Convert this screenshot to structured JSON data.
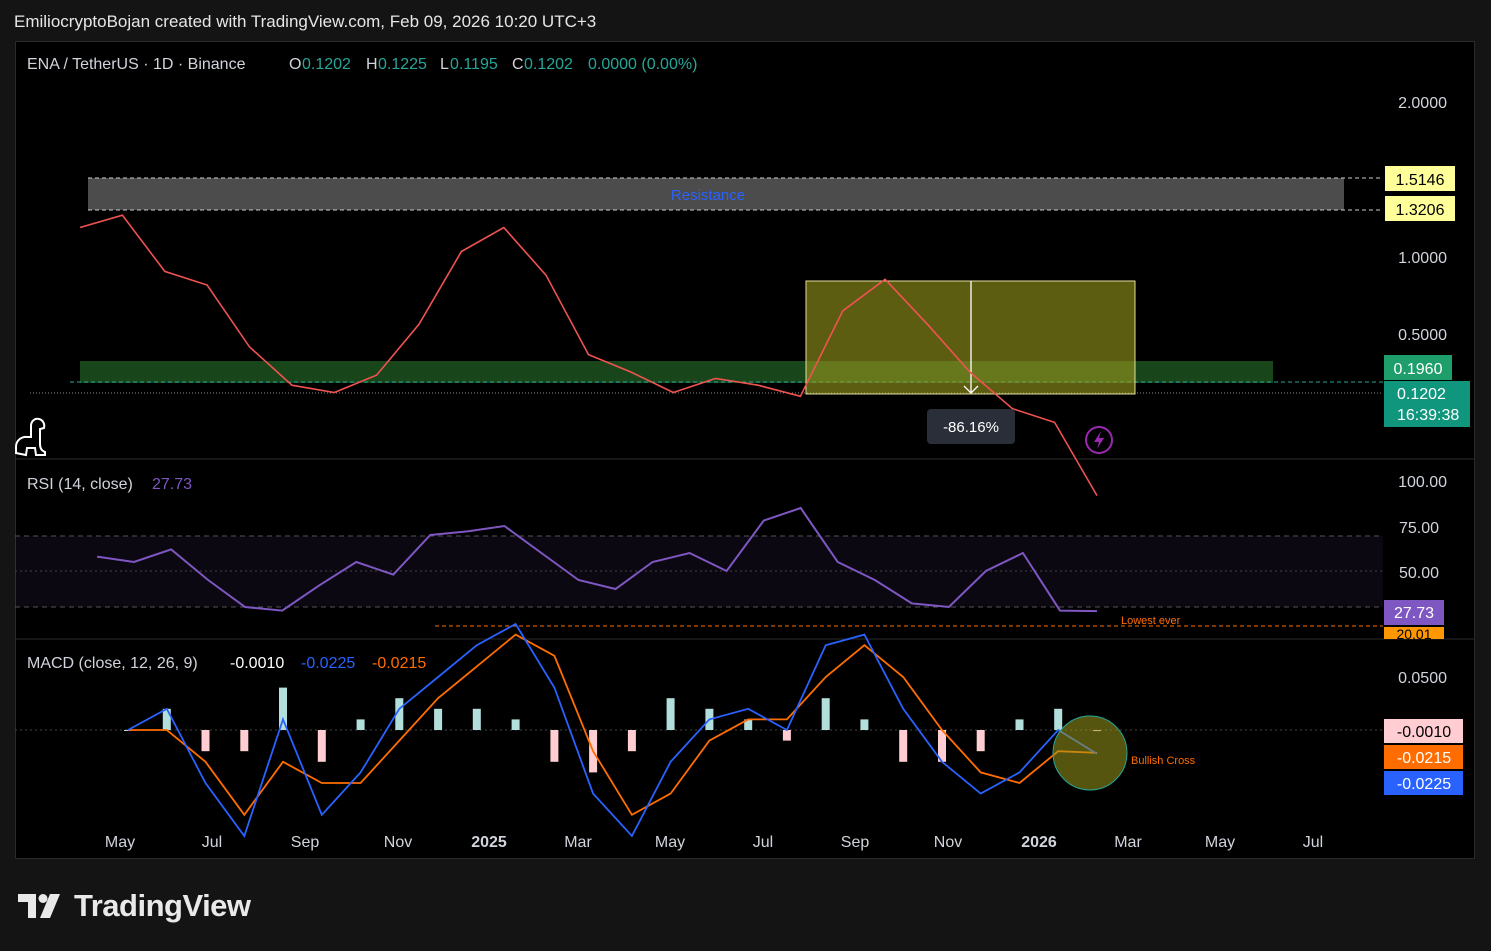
{
  "header": {
    "attribution": "EmiliocryptoBojan created with TradingView.com, Feb 09, 2026 10:20 UTC+3"
  },
  "legend": {
    "symbol": "ENA / TetherUS · 1D · Binance",
    "o_label": "O",
    "o_value": "0.1202",
    "h_label": "H",
    "h_value": "0.1225",
    "l_label": "L",
    "l_value": "0.1195",
    "c_label": "C",
    "c_value": "0.1202",
    "change": "0.0000 (0.00%)"
  },
  "price_axis": [
    "2.0000",
    "1.0000",
    "0.5000"
  ],
  "price_tags": {
    "resistance_top": "1.5146",
    "resistance_bottom": "1.3206",
    "support": "0.1960",
    "last": "0.1202",
    "countdown": "16:39:38"
  },
  "annotations": {
    "resistance": "Resistance",
    "drop_pct": "-86.16%",
    "lowest_ever": "Lowest ever",
    "bullish_cross": "Bullish Cross"
  },
  "rsi": {
    "title": "RSI (14, close)",
    "value": "27.73",
    "axis": [
      "100.00",
      "75.00",
      "50.00"
    ],
    "tag_value": "27.73",
    "tag_low": "20.01"
  },
  "macd": {
    "title": "MACD (close, 12, 26, 9)",
    "hist": "-0.0010",
    "macd": "-0.0225",
    "signal": "-0.0215",
    "axis": [
      "0.0500"
    ],
    "tag_hist": "-0.0010",
    "tag_signal": "-0.0215",
    "tag_macd": "-0.0225"
  },
  "time_axis": [
    "May",
    "Jul",
    "Sep",
    "Nov",
    "2025",
    "Mar",
    "May",
    "Jul",
    "Sep",
    "Nov",
    "2026",
    "Mar",
    "May",
    "Jul"
  ],
  "colors": {
    "up": "#26a69a",
    "down": "#ef5350",
    "rsi": "#7e57c2",
    "macd": "#2962ff",
    "signal": "#ff6d00",
    "tag_yellow": "#ffff99",
    "tag_green": "#1e9e6a",
    "projection": "#7a7a1a"
  },
  "brand": {
    "name": "TradingView"
  },
  "chart_data": {
    "type": "line",
    "title": "ENA / TetherUS · 1D · Binance",
    "x": [
      "2024-04",
      "2024-04",
      "2024-05",
      "2024-06",
      "2024-07",
      "2024-08",
      "2024-09",
      "2024-10",
      "2024-11",
      "2024-12",
      "2024-12",
      "2025-01",
      "2025-02",
      "2025-03",
      "2025-04",
      "2025-05",
      "2025-06",
      "2025-07",
      "2025-08",
      "2025-09",
      "2025-10",
      "2025-11",
      "2025-12",
      "2026-01",
      "2026-02"
    ],
    "series": [
      {
        "values": [
          1.3,
          1.45,
          0.88,
          0.78,
          0.45,
          0.32,
          0.3,
          0.35,
          0.55,
          1.05,
          1.3,
          0.85,
          0.42,
          0.36,
          0.3,
          0.34,
          0.32,
          0.29,
          0.62,
          0.82,
          0.55,
          0.36,
          0.26,
          0.23,
          0.12
        ]
      }
    ],
    "ylim": [
      0.1,
      2.2
    ],
    "log_scale": true,
    "levels": {
      "resistance_top": 1.5146,
      "resistance_bottom": 1.3206,
      "support": 0.196,
      "last": 0.1202
    },
    "rsi_series": [
      58,
      55,
      62,
      45,
      30,
      28,
      42,
      55,
      48,
      70,
      72,
      75,
      60,
      45,
      40,
      55,
      60,
      50,
      78,
      85,
      55,
      45,
      32,
      30,
      50,
      60,
      28,
      27.73
    ],
    "macd_series": [
      0.0,
      0.02,
      -0.05,
      -0.1,
      0.01,
      -0.08,
      -0.04,
      0.02,
      0.05,
      0.08,
      0.1,
      0.04,
      -0.06,
      -0.1,
      -0.03,
      0.01,
      0.02,
      0.0,
      0.08,
      0.09,
      0.02,
      -0.03,
      -0.06,
      -0.04,
      0.0,
      -0.0225
    ],
    "signal_series": [
      0.0,
      0.0,
      -0.03,
      -0.08,
      -0.03,
      -0.05,
      -0.05,
      -0.01,
      0.03,
      0.06,
      0.09,
      0.07,
      -0.02,
      -0.08,
      -0.06,
      -0.01,
      0.01,
      0.01,
      0.05,
      0.08,
      0.05,
      0.0,
      -0.04,
      -0.05,
      -0.02,
      -0.0215
    ],
    "grid": false
  }
}
